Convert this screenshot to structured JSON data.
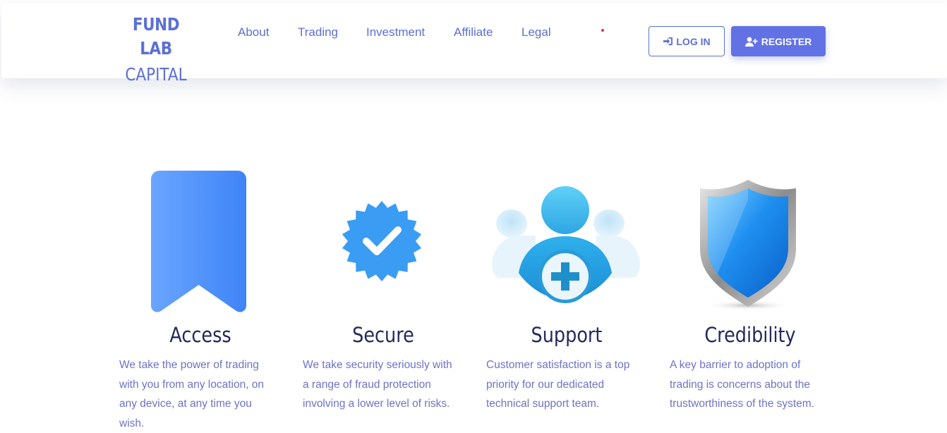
{
  "header": {
    "logo_line1": "FUND LAB",
    "logo_line2": "CAPITAL",
    "nav": [
      "About",
      "Trading",
      "Investment",
      "Affiliate",
      "Legal"
    ],
    "login_label": "LOG IN",
    "register_label": "REGISTER"
  },
  "features": [
    {
      "title": "Access",
      "desc": "We take the power of trading with you from any location, on any device, at any time you wish.",
      "icon": "bookmark-icon"
    },
    {
      "title": "Secure",
      "desc": "We take security seriously with a range of fraud protection involving a lower level of risks.",
      "icon": "verified-badge-icon"
    },
    {
      "title": "Support",
      "desc": "Customer satisfaction is a top priority for our dedicated technical support team.",
      "icon": "support-team-icon"
    },
    {
      "title": "Credibility",
      "desc": "A key barrier to adoption of trading is concerns about the trustworthiness of the system.",
      "icon": "shield-icon"
    }
  ],
  "colors": {
    "accent": "#6272e4",
    "nav_text": "#5b6fd6",
    "heading": "#26285c",
    "body_text": "#6d73c8"
  }
}
